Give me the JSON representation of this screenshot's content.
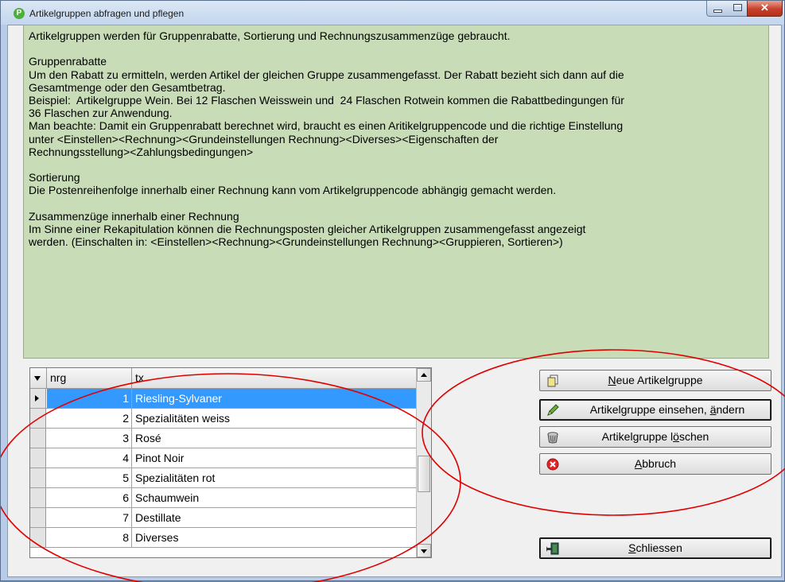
{
  "window": {
    "title": "Artikelgruppen abfragen und pflegen",
    "app_icon": "P"
  },
  "info": {
    "paragraphs": [
      "Artikelgruppen werden für Gruppenrabatte, Sortierung und Rechnungszusammenzüge gebraucht.",
      "",
      "Gruppenrabatte",
      "Um den Rabatt zu ermitteln, werden Artikel der gleichen Gruppe zusammengefasst. Der Rabatt bezieht sich dann auf die",
      "Gesamtmenge oder den Gesamtbetrag.",
      "Beispiel:  Artikelgruppe Wein. Bei 12 Flaschen Weisswein und  24 Flaschen Rotwein kommen die Rabattbedingungen für",
      "36 Flaschen zur Anwendung.",
      "Man beachte: Damit ein Gruppenrabatt berechnet wird, braucht es einen Aritikelgruppencode und die richtige Einstellung",
      "unter <Einstellen><Rechnung><Grundeinstellungen Rechnung><Diverses><Eigenschaften der",
      "Rechnungsstellung><Zahlungsbedingungen>",
      "",
      "Sortierung",
      "Die Postenreihenfolge innerhalb einer Rechnung kann vom Artikelgruppencode abhängig gemacht werden.",
      "",
      "Zusammenzüge innerhalb einer Rechnung",
      "Im Sinne einer Rekapitulation können die Rechnungsposten gleicher Artikelgruppen zusammengefasst angezeigt",
      "werden. (Einschalten in: <Einstellen><Rechnung><Grundeinstellungen Rechnung><Gruppieren, Sortieren>)"
    ]
  },
  "grid": {
    "columns": [
      "nrg",
      "tx"
    ],
    "rows": [
      {
        "nrg": "1",
        "tx": "Riesling-Sylvaner"
      },
      {
        "nrg": "2",
        "tx": "Spezialitäten weiss"
      },
      {
        "nrg": "3",
        "tx": "Rosé"
      },
      {
        "nrg": "4",
        "tx": "Pinot Noir"
      },
      {
        "nrg": "5",
        "tx": "Spezialitäten rot"
      },
      {
        "nrg": "6",
        "tx": "Schaumwein"
      },
      {
        "nrg": "7",
        "tx": "Destillate"
      },
      {
        "nrg": "8",
        "tx": "Diverses"
      }
    ],
    "selected_row": 1
  },
  "actions": {
    "new_label_pre": "",
    "new_label_acc": "N",
    "new_label_post": "eue Artikelgruppe",
    "edit_label_pre": "Artikelgruppe einsehen, ",
    "edit_label_acc": "ä",
    "edit_label_post": "ndern",
    "delete_label_pre": "Artikelgruppe l",
    "delete_label_acc": "ö",
    "delete_label_post": "schen",
    "cancel_label_pre": "",
    "cancel_label_acc": "A",
    "cancel_label_post": "bbruch",
    "close_label_pre": "",
    "close_label_acc": "S",
    "close_label_post": "chliessen"
  },
  "colors": {
    "info_bg": "#c8ddb7",
    "selection": "#3399ff",
    "annotation": "#e00000"
  }
}
